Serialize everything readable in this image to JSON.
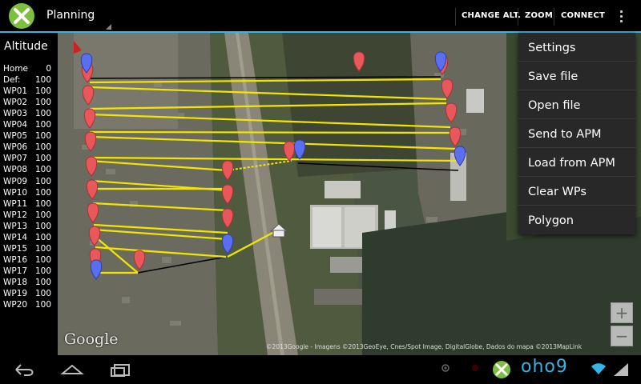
{
  "app": {
    "title": "Planning",
    "actions": {
      "change_alt": "CHANGE ALT.",
      "zoom": "ZOOM",
      "connect": "CONNECT"
    }
  },
  "altitude": {
    "title": "Altitude",
    "rows": [
      {
        "label": "Home",
        "value": "0"
      },
      {
        "label": "Def:",
        "value": "100"
      },
      {
        "label": "WP01",
        "value": "100"
      },
      {
        "label": "WP02",
        "value": "100"
      },
      {
        "label": "WP03",
        "value": "100"
      },
      {
        "label": "WP04",
        "value": "100"
      },
      {
        "label": "WP05",
        "value": "100"
      },
      {
        "label": "WP06",
        "value": "100"
      },
      {
        "label": "WP07",
        "value": "100"
      },
      {
        "label": "WP08",
        "value": "100"
      },
      {
        "label": "WP09",
        "value": "100"
      },
      {
        "label": "WP10",
        "value": "100"
      },
      {
        "label": "WP11",
        "value": "100"
      },
      {
        "label": "WP12",
        "value": "100"
      },
      {
        "label": "WP13",
        "value": "100"
      },
      {
        "label": "WP14",
        "value": "100"
      },
      {
        "label": "WP15",
        "value": "100"
      },
      {
        "label": "WP16",
        "value": "100"
      },
      {
        "label": "WP17",
        "value": "100"
      },
      {
        "label": "WP18",
        "value": "100"
      },
      {
        "label": "WP19",
        "value": "100"
      },
      {
        "label": "WP20",
        "value": "100"
      }
    ]
  },
  "menu": {
    "items": [
      "Settings",
      "Save file",
      "Open file",
      "Send to APM",
      "Load from APM",
      "Clear WPs",
      "Polygon"
    ]
  },
  "map": {
    "watermark": "Google",
    "copyright": "©2013Google - Imagens ©2013GeoEye, Cnes/Spot Image, DigitalGlobe, Dados do mapa ©2013MapLink",
    "zoom_in": "+",
    "zoom_out": "−"
  },
  "status": {
    "clock": "oho9"
  },
  "colors": {
    "accent": "#33b5e5",
    "path": "#f2e600",
    "marker_red": "#e8585a",
    "marker_blue": "#5a6ef0"
  }
}
